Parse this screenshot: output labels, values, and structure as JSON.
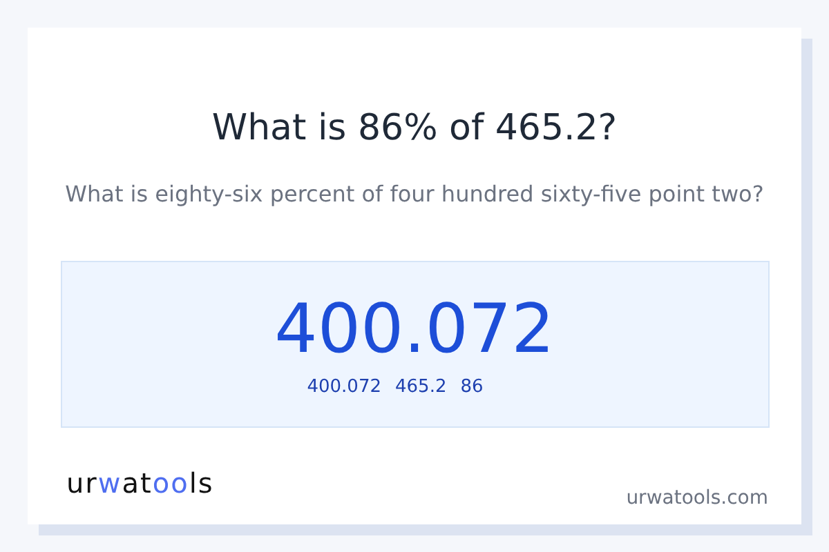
{
  "title": "What is 86% of 465.2?",
  "subtitle": "What is eighty-six percent of four hundred sixty-five point two?",
  "result": {
    "value": "400.072",
    "details": [
      "400.072",
      "465.2",
      "86"
    ]
  },
  "logo": [
    {
      "text": "ur",
      "accent": false
    },
    {
      "text": "w",
      "accent": true
    },
    {
      "text": "at",
      "accent": false
    },
    {
      "text": "oo",
      "accent": true
    },
    {
      "text": "ls",
      "accent": false
    }
  ],
  "site": "urwatools.com"
}
